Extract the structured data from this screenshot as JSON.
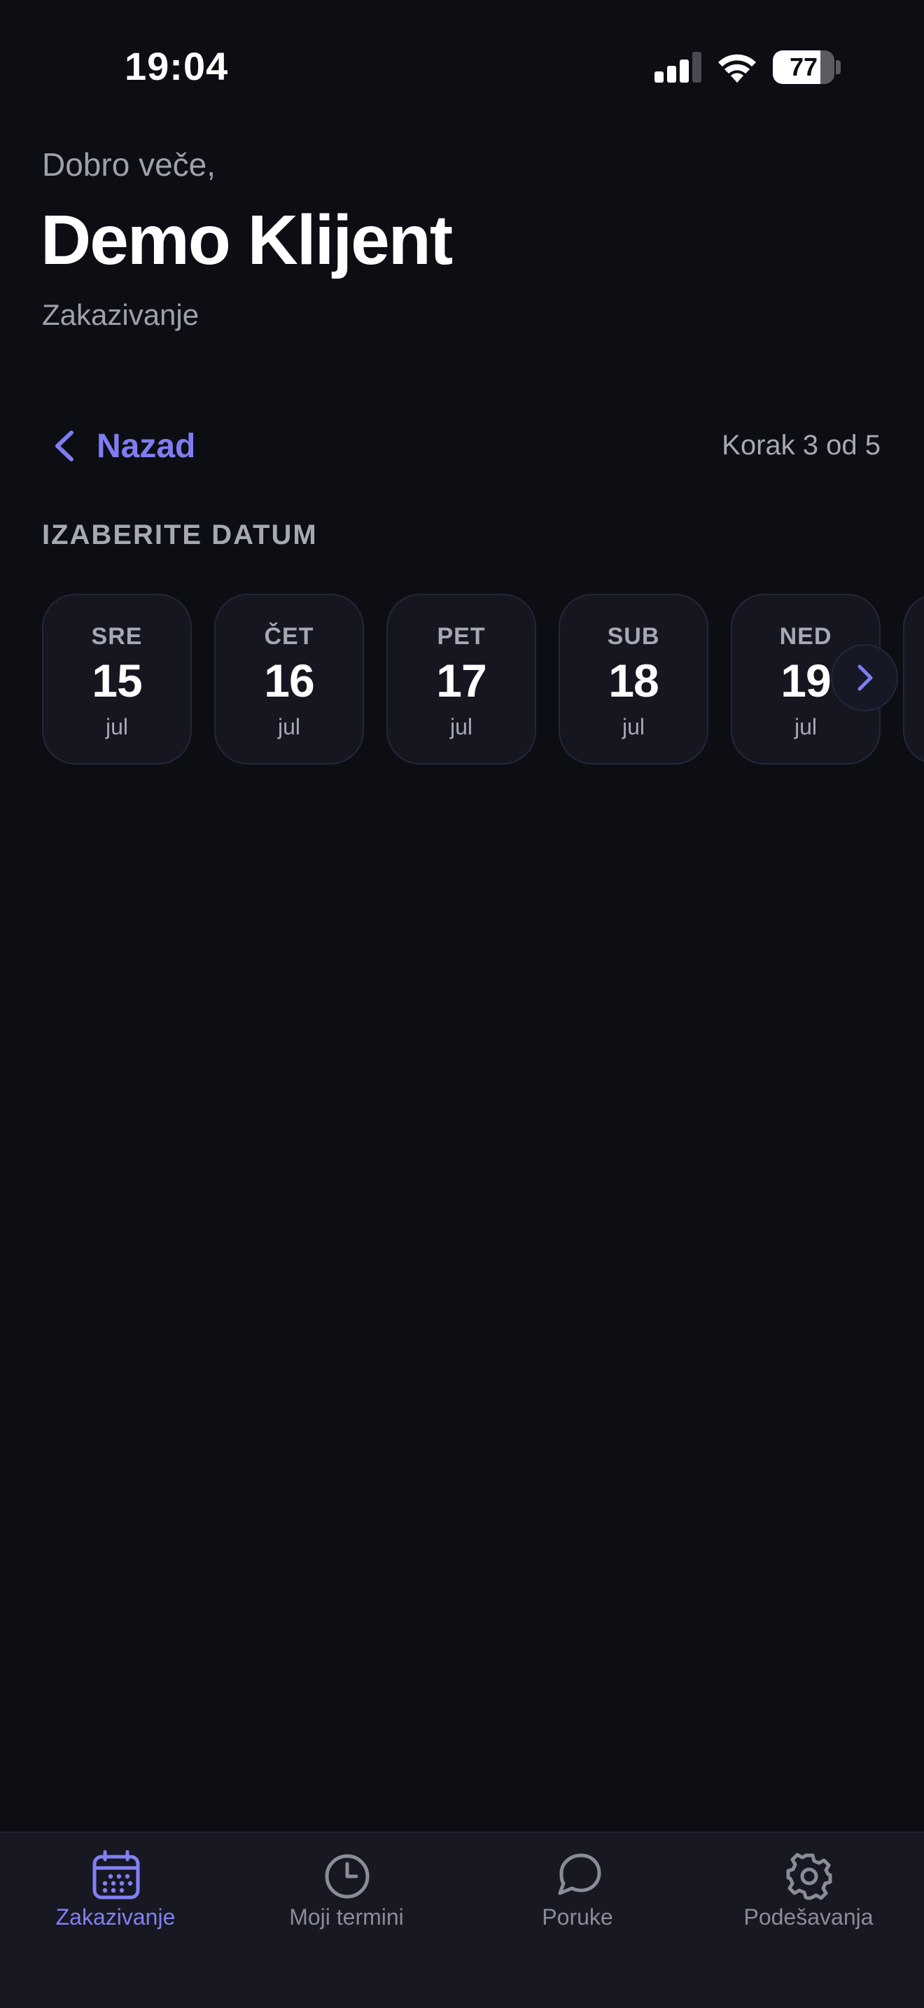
{
  "status_bar": {
    "time": "19:04",
    "battery_level": "77",
    "battery_fraction": 0.77,
    "signal_bars": 3
  },
  "header": {
    "greeting": "Dobro veče,",
    "user_name": "Demo Klijent",
    "subtitle": "Zakazivanje"
  },
  "nav": {
    "back_label": "Nazad",
    "step_text": "Korak 3 od 5"
  },
  "section": {
    "label": "IZABERITE DATUM"
  },
  "dates": [
    {
      "dow": "SRE",
      "day": "15",
      "month": "jul"
    },
    {
      "dow": "ČET",
      "day": "16",
      "month": "jul"
    },
    {
      "dow": "PET",
      "day": "17",
      "month": "jul"
    },
    {
      "dow": "SUB",
      "day": "18",
      "month": "jul"
    },
    {
      "dow": "NED",
      "day": "19",
      "month": "jul"
    }
  ],
  "tabs": [
    {
      "label": "Zakazivanje",
      "icon": "calendar-icon",
      "active": true
    },
    {
      "label": "Moji termini",
      "icon": "clock-icon",
      "active": false
    },
    {
      "label": "Poruke",
      "icon": "chat-bubble-icon",
      "active": false
    },
    {
      "label": "Podešavanja",
      "icon": "gear-icon",
      "active": false
    }
  ],
  "colors": {
    "background": "#0d0e13",
    "accent": "#7f7df3",
    "card": "#151620",
    "muted_text": "#a6a9b3"
  }
}
